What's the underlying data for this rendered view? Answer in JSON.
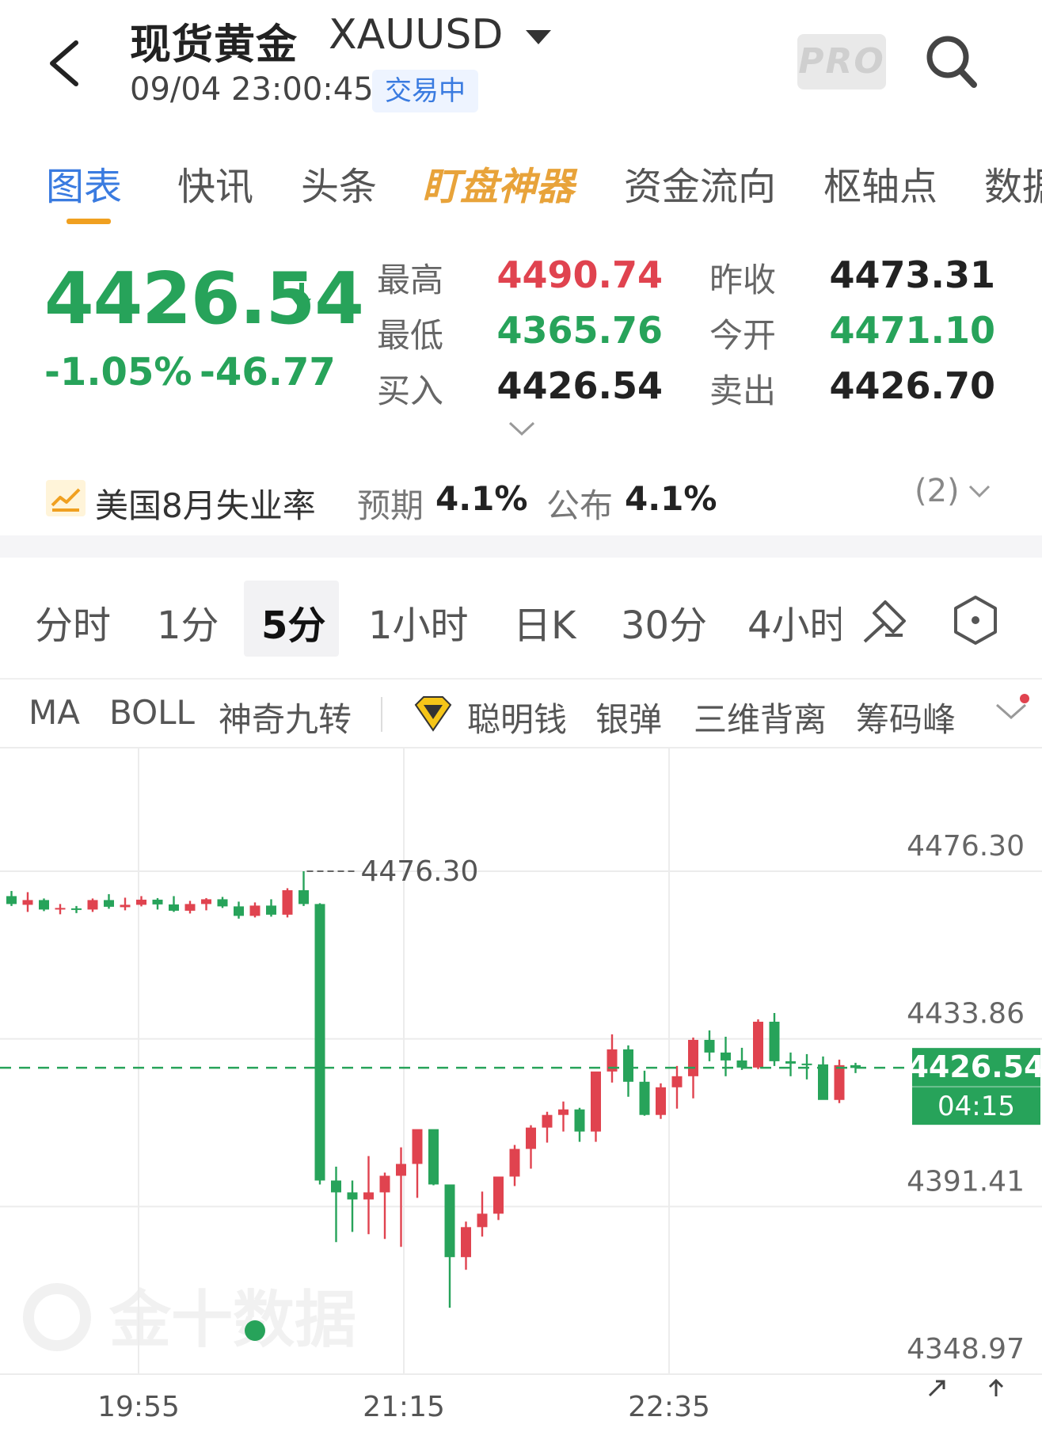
{
  "header": {
    "title": "现货黄金",
    "symbol": "XAUUSD",
    "datetime": "09/04 23:00:45",
    "status_badge": "交易中",
    "pro_label": "PRO"
  },
  "tabs": [
    {
      "label": "图表",
      "active": true
    },
    {
      "label": "快讯"
    },
    {
      "label": "头条"
    },
    {
      "label": "盯盘神器",
      "special": true
    },
    {
      "label": "资金流向"
    },
    {
      "label": "枢轴点"
    },
    {
      "label": "数据"
    }
  ],
  "quote": {
    "price": "4426.54",
    "change_pct": "-1.05%",
    "change": "-46.77",
    "fields": [
      {
        "label": "最高",
        "value": "4490.74",
        "color": "red"
      },
      {
        "label": "最低",
        "value": "4365.76",
        "color": "green"
      },
      {
        "label": "买入",
        "value": "4426.54",
        "color": "dark"
      },
      {
        "label": "昨收",
        "value": "4473.31",
        "color": "dark"
      },
      {
        "label": "今开",
        "value": "4471.10",
        "color": "green"
      },
      {
        "label": "卖出",
        "value": "4426.70",
        "color": "dark"
      }
    ]
  },
  "news": {
    "title": "美国8月失业率",
    "expected_label": "预期",
    "expected_value": "4.1%",
    "actual_label": "公布",
    "actual_value": "4.1%",
    "count": "(2)"
  },
  "periods": [
    {
      "label": "分时"
    },
    {
      "label": "1分"
    },
    {
      "label": "5分",
      "active": true
    },
    {
      "label": "1小时"
    },
    {
      "label": "日K"
    },
    {
      "label": "30分"
    },
    {
      "label": "4小时"
    }
  ],
  "indicators": [
    "MA",
    "BOLL",
    "神奇九转",
    "聪明钱",
    "银弹",
    "三维背离",
    "筹码峰"
  ],
  "colors": {
    "up": "#e0434f",
    "down": "#27a35a",
    "accent": "#3a7be0",
    "tab_underline": "#f0a020"
  },
  "chart_data": {
    "type": "candlestick",
    "y_ticks": [
      "4476.30",
      "4433.86",
      "4391.41",
      "4348.97"
    ],
    "x_ticks": [
      "19:55",
      "21:15",
      "22:35"
    ],
    "high_marker": "4476.30",
    "low_marker": "4365.76",
    "current_price": "4426.54",
    "countdown": "04:15",
    "ylim": [
      4348.97,
      4476.3
    ],
    "watermark": "金十数据",
    "candles": [
      [
        4470.0,
        4471.3,
        4467.5,
        4468.0
      ],
      [
        4467.8,
        4471.0,
        4466.0,
        4469.0
      ],
      [
        4469.0,
        4469.4,
        4466.2,
        4466.6
      ],
      [
        4466.6,
        4468.0,
        4465.4,
        4467.0
      ],
      [
        4466.9,
        4467.5,
        4465.7,
        4466.6
      ],
      [
        4466.6,
        4469.4,
        4466.0,
        4469.0
      ],
      [
        4469.0,
        4470.5,
        4466.8,
        4467.3
      ],
      [
        4467.2,
        4469.6,
        4466.4,
        4467.8
      ],
      [
        4467.8,
        4470.0,
        4467.4,
        4469.1
      ],
      [
        4469.1,
        4469.5,
        4466.6,
        4467.9
      ],
      [
        4467.9,
        4470.0,
        4466.0,
        4466.3
      ],
      [
        4466.3,
        4468.8,
        4465.6,
        4468.0
      ],
      [
        4468.0,
        4469.5,
        4466.4,
        4469.2
      ],
      [
        4469.2,
        4469.8,
        4467.0,
        4467.4
      ],
      [
        4467.4,
        4468.6,
        4464.3,
        4465.0
      ],
      [
        4465.0,
        4468.4,
        4464.6,
        4467.6
      ],
      [
        4467.6,
        4469.2,
        4464.8,
        4465.3
      ],
      [
        4465.3,
        4472.0,
        4464.6,
        4471.5
      ],
      [
        4471.5,
        4476.3,
        4467.5,
        4468.0
      ],
      [
        4468.0,
        4468.2,
        4397.0,
        4398.0
      ],
      [
        4398.0,
        4401.5,
        4382.4,
        4395.0
      ],
      [
        4395.0,
        4398.0,
        4385.0,
        4393.2
      ],
      [
        4393.2,
        4404.2,
        4384.4,
        4395.0
      ],
      [
        4395.0,
        4400.0,
        4383.2,
        4399.2
      ],
      [
        4399.2,
        4406.4,
        4381.2,
        4402.2
      ],
      [
        4402.2,
        4410.0,
        4393.6,
        4411.0
      ],
      [
        4411.0,
        4410.8,
        4396.8,
        4397.0
      ],
      [
        4397.0,
        4396.8,
        4365.8,
        4378.6
      ],
      [
        4378.6,
        4387.6,
        4375.4,
        4386.2
      ],
      [
        4386.2,
        4395.2,
        4383.8,
        4389.6
      ],
      [
        4389.6,
        4396.4,
        4388.0,
        4399.0
      ],
      [
        4399.0,
        4407.0,
        4396.6,
        4406.0
      ],
      [
        4406.0,
        4412.0,
        4401.0,
        4411.4
      ],
      [
        4411.4,
        4415.4,
        4407.6,
        4414.6
      ],
      [
        4414.6,
        4418.0,
        4410.4,
        4416.0
      ],
      [
        4416.0,
        4416.4,
        4407.8,
        4410.4
      ],
      [
        4410.4,
        4425.0,
        4407.8,
        4425.6
      ],
      [
        4425.6,
        4435.0,
        4422.8,
        4431.2
      ],
      [
        4431.2,
        4432.2,
        4419.2,
        4423.0
      ],
      [
        4423.0,
        4425.8,
        4414.4,
        4414.6
      ],
      [
        4414.6,
        4422.6,
        4413.6,
        4421.6
      ],
      [
        4421.6,
        4427.0,
        4416.2,
        4424.4
      ],
      [
        4424.4,
        4434.2,
        4418.8,
        4433.6
      ],
      [
        4433.6,
        4436.0,
        4428.2,
        4430.4
      ],
      [
        4430.4,
        4434.4,
        4424.4,
        4428.4
      ],
      [
        4428.4,
        4431.6,
        4426.0,
        4426.6
      ],
      [
        4426.6,
        4438.8,
        4426.2,
        4438.2
      ],
      [
        4438.2,
        4440.4,
        4427.0,
        4428.2
      ],
      [
        4428.2,
        4430.4,
        4424.4,
        4427.6
      ],
      [
        4427.6,
        4430.0,
        4423.6,
        4427.4
      ],
      [
        4427.4,
        4429.4,
        4419.0,
        4418.4
      ],
      [
        4418.4,
        4428.6,
        4417.6,
        4427.2
      ],
      [
        4427.2,
        4427.8,
        4425.2,
        4426.5
      ]
    ]
  }
}
